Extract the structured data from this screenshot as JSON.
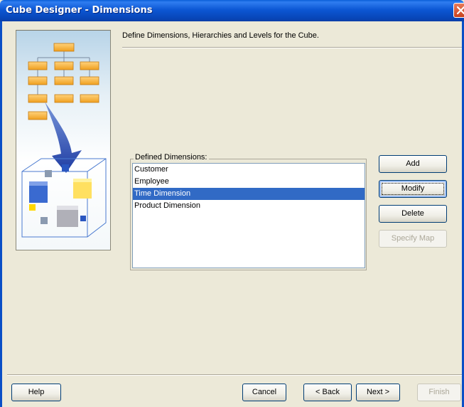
{
  "window": {
    "title": "Cube Designer - Dimensions",
    "close_icon": "close-icon"
  },
  "graphic": {
    "icon": "cube-hierarchy-illustration-icon"
  },
  "instruction": "Define Dimensions, Hierarchies and Levels for the Cube.",
  "dimensions_group": {
    "label": "Defined Dimensions:",
    "items": [
      {
        "label": "Customer",
        "selected": false
      },
      {
        "label": "Employee",
        "selected": false
      },
      {
        "label": "Time Dimension",
        "selected": true
      },
      {
        "label": "Product Dimension",
        "selected": false
      }
    ]
  },
  "side_buttons": {
    "add": "Add",
    "modify": "Modify",
    "delete": "Delete",
    "specify_map": "Specify Map"
  },
  "footer": {
    "help": "Help",
    "cancel": "Cancel",
    "back": "< Back",
    "next": "Next >",
    "finish": "Finish"
  },
  "colors": {
    "title_bar": "#0a5fd8",
    "selection": "#316ac5",
    "window_bg": "#ece9d8"
  }
}
